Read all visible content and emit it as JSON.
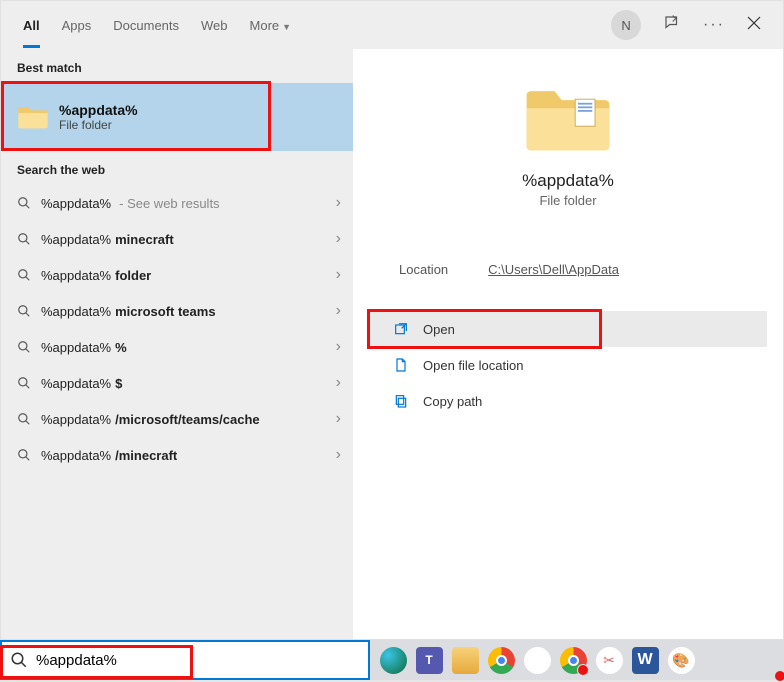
{
  "header": {
    "tabs": [
      "All",
      "Apps",
      "Documents",
      "Web",
      "More"
    ],
    "avatar_initial": "N"
  },
  "left": {
    "best_match_label": "Best match",
    "best_match": {
      "title": "%appdata%",
      "subtitle": "File folder"
    },
    "web_label": "Search the web",
    "suggestions": [
      {
        "prefix": "%appdata%",
        "bold": "",
        "hint": " - See web results"
      },
      {
        "prefix": "%appdata%",
        "bold": " minecraft",
        "hint": ""
      },
      {
        "prefix": "%appdata%",
        "bold": " folder",
        "hint": ""
      },
      {
        "prefix": "%appdata%",
        "bold": " microsoft teams",
        "hint": ""
      },
      {
        "prefix": "%appdata%",
        "bold": "%",
        "hint": ""
      },
      {
        "prefix": "%appdata%",
        "bold": "$",
        "hint": ""
      },
      {
        "prefix": "%appdata%",
        "bold": "/microsoft/teams/cache",
        "hint": ""
      },
      {
        "prefix": "%appdata%",
        "bold": "/minecraft",
        "hint": ""
      }
    ]
  },
  "right": {
    "title": "%appdata%",
    "subtitle": "File folder",
    "location_label": "Location",
    "location_value": "C:\\Users\\Dell\\AppData",
    "actions": {
      "open": "Open",
      "open_file_location": "Open file location",
      "copy_path": "Copy path"
    }
  },
  "taskbar": {
    "search_value": "%appdata%"
  }
}
